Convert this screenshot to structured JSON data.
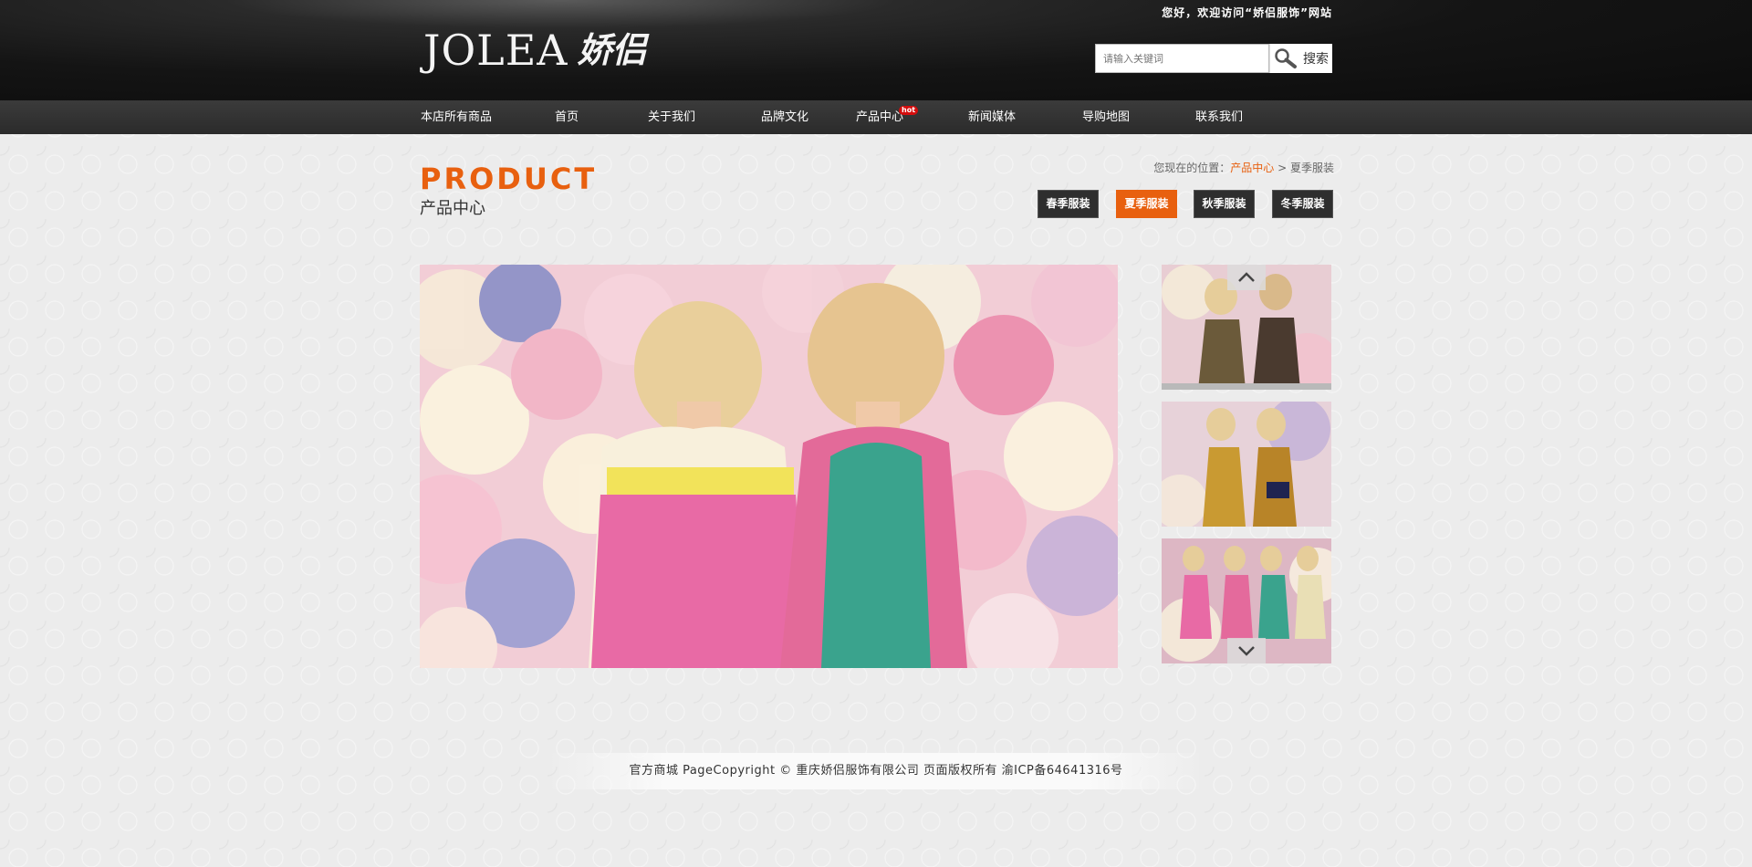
{
  "header": {
    "welcome_text": "您好，欢迎访问“娇侣服饰”网站",
    "logo_en": "JOLEA",
    "logo_cn": "娇侣",
    "search": {
      "placeholder": "请输入关键词",
      "button_label": "搜索"
    }
  },
  "nav": {
    "items": [
      {
        "label": "本店所有商品"
      },
      {
        "label": "首页"
      },
      {
        "label": "关于我们"
      },
      {
        "label": "品牌文化"
      },
      {
        "label": "产品中心",
        "badge": "hot"
      },
      {
        "label": "新闻媒体"
      },
      {
        "label": "导购地图"
      },
      {
        "label": "联系我们"
      }
    ]
  },
  "section": {
    "title_en": "PRODUCT",
    "title_cn": "产品中心"
  },
  "breadcrumb": {
    "prefix": "您现在的位置：",
    "link": "产品中心",
    "separator": ">",
    "current": "夏季服装"
  },
  "season_tabs": [
    {
      "label": "春季服装",
      "active": false
    },
    {
      "label": "夏季服装",
      "active": true
    },
    {
      "label": "秋季服装",
      "active": false
    },
    {
      "label": "冬季服装",
      "active": false
    }
  ],
  "footer": {
    "text": "官方商城 PageCopyright © 重庆娇侣服饰有限公司 页面版权所有 渝ICP备64641316号"
  },
  "colors": {
    "accent": "#e8600f",
    "header_bg": "#141414",
    "nav_bg": "#333333",
    "hot_badge": "#d40d0d"
  },
  "icons": {
    "search": "magnifier-icon",
    "scroll_up": "chevron-up-icon",
    "scroll_down": "chevron-down-icon"
  }
}
